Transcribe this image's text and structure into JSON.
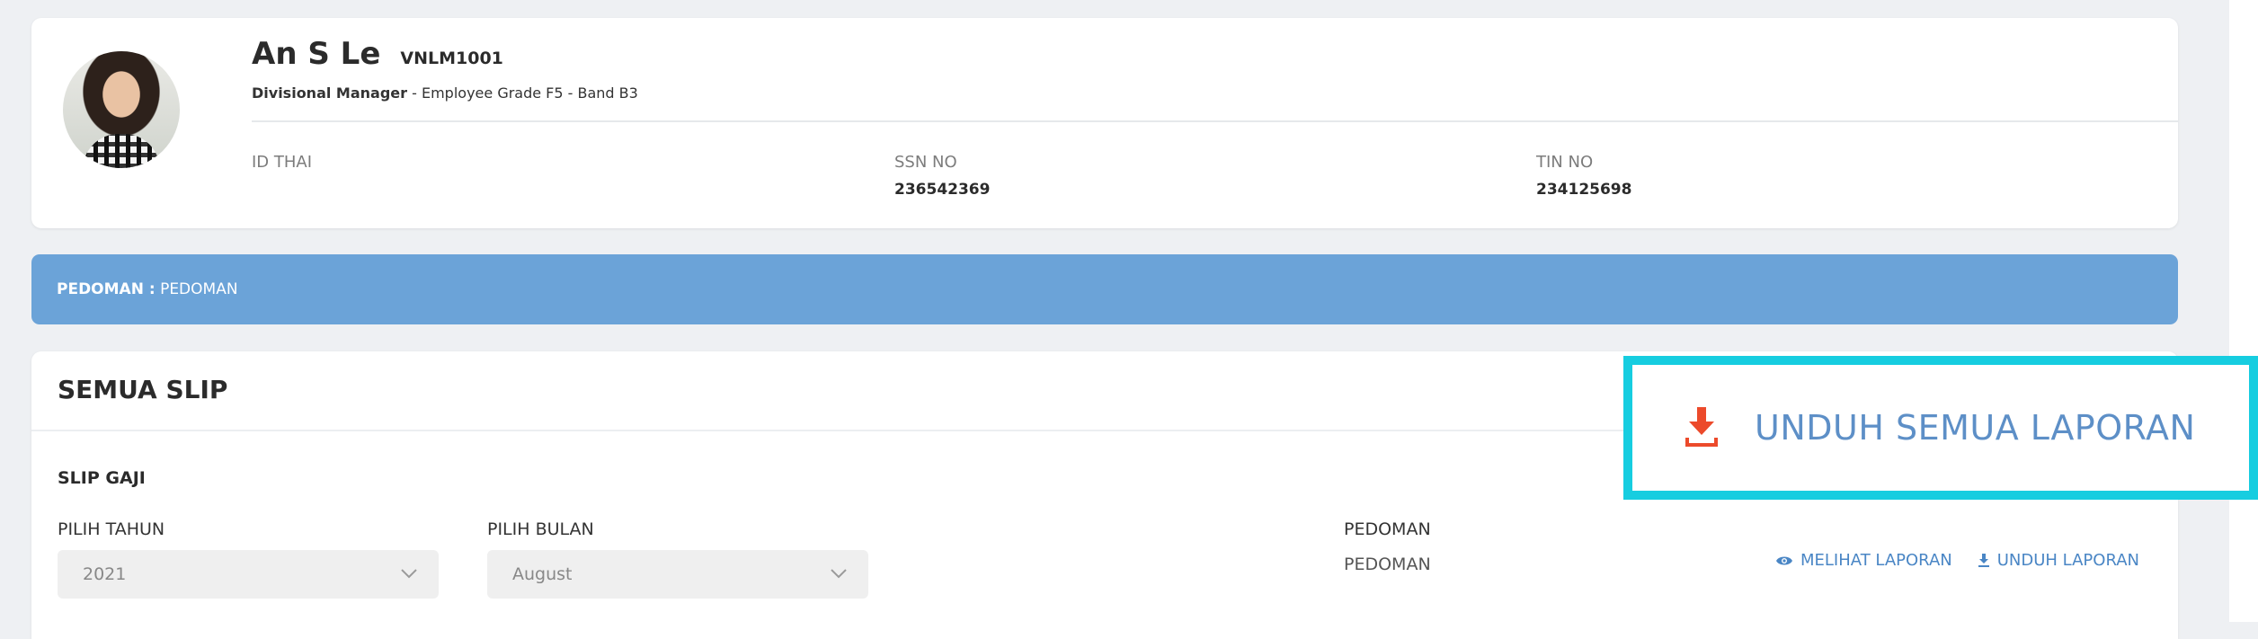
{
  "employee": {
    "name": "An S Le",
    "code": "VNLM1001",
    "position": "Divisional Manager",
    "grade_band": "- Employee Grade F5 - Band B3",
    "fields": [
      {
        "label": "ID THAI",
        "value": ""
      },
      {
        "label": "SSN NO",
        "value": "236542369"
      },
      {
        "label": "TIN NO",
        "value": "234125698"
      }
    ]
  },
  "banner": {
    "key": "PEDOMAN :",
    "value": "PEDOMAN"
  },
  "slips": {
    "title": "SEMUA SLIP",
    "subtitle": "SLIP GAJI",
    "year_label": "PILIH TAHUN",
    "year_value": "2021",
    "month_label": "PILIH BULAN",
    "month_value": "August",
    "guide_label": "PEDOMAN",
    "guide_value": "PEDOMAN",
    "view_report": "MELIHAT LAPORAN",
    "download_report": "UNDUH LAPORAN",
    "download_all": "UNDUH SEMUA LAPORAN"
  },
  "colors": {
    "banner": "#6ba3d8",
    "highlight": "#16cde0",
    "download_icon": "#ec4a2b",
    "link": "#4a86c5"
  },
  "icons": {
    "download_all": "download-icon",
    "view": "eye-icon",
    "download": "download-icon",
    "dropdown": "chevron-down-icon"
  }
}
